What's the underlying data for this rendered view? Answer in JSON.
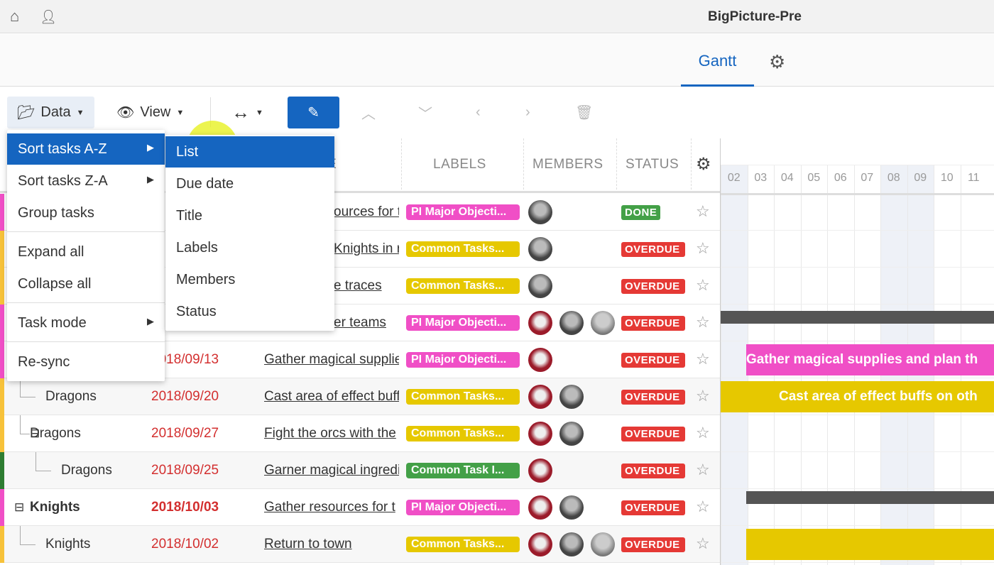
{
  "app": {
    "title": "BigPicture-Pre",
    "home_icon": "home-icon",
    "user_settings_icon": "user-gear-icon"
  },
  "tabs": {
    "gantt": "Gantt",
    "settings_icon": "gear-icon"
  },
  "toolbar": {
    "data": "Data",
    "view": "View",
    "fit_icon": "arrows-horizontal-icon",
    "edit_icon": "pencil-icon",
    "up_icon": "chevron-up-icon",
    "down_icon": "chevron-down-icon",
    "left_icon": "chevron-left-icon",
    "right_icon": "chevron-right-icon",
    "delete_icon": "trash-icon"
  },
  "columns": {
    "title": "LE",
    "labels": "LABELS",
    "members": "MEMBERS",
    "status": "STATUS"
  },
  "colors": {
    "accent": "#1565c0",
    "pink": "#f04fc6",
    "yellow": "#e6c800",
    "green": "#43a047",
    "overdue": "#e53935"
  },
  "rows": [
    {
      "name": "",
      "date": "",
      "title": "ources for t",
      "label": "PI Major Objecti...",
      "label_color": "#f04fc6",
      "members": 1,
      "status": "DONE",
      "strip": "#f04fc6",
      "partial": true
    },
    {
      "name": "",
      "date": "",
      "title": "Knights in r",
      "label": "Common Tasks...",
      "label_color": "#e6c800",
      "members": 1,
      "status": "OVERDUE",
      "strip": "#f7c23a",
      "partial": true
    },
    {
      "name": "",
      "date": "",
      "title": "e traces",
      "label": "Common Tasks...",
      "label_color": "#e6c800",
      "members": 1,
      "status": "OVERDUE",
      "strip": "#f7c23a",
      "partial": true
    },
    {
      "name": "",
      "date": "",
      "title": "er teams",
      "label": "PI Major Objecti...",
      "label_color": "#f04fc6",
      "members": 3,
      "status": "OVERDUE",
      "strip": "#f04fc6",
      "partial": true
    },
    {
      "name": "",
      "date": "2018/09/13",
      "title": "Gather magical supplies",
      "label": "PI Major Objecti...",
      "label_color": "#f04fc6",
      "members": 1,
      "status": "OVERDUE",
      "strip": "#f04fc6"
    },
    {
      "name": "Dragons",
      "date": "2018/09/20",
      "title": "Cast area of effect buffs",
      "label": "Common Tasks...",
      "label_color": "#e6c800",
      "members": 2,
      "status": "OVERDUE",
      "strip": "#f7c23a",
      "indent": 1
    },
    {
      "name": "Dragons",
      "date": "2018/09/27",
      "title": "Fight the orcs with the",
      "label": "Common Tasks...",
      "label_color": "#e6c800",
      "members": 2,
      "status": "OVERDUE",
      "strip": "#f7c23a",
      "indent": 1,
      "toggle": "⊟"
    },
    {
      "name": "Dragons",
      "date": "2018/09/25",
      "title": "Garner magical ingredients",
      "label": "Common Task I...",
      "label_color": "#43a047",
      "members": 1,
      "status": "OVERDUE",
      "strip": "#2e7d32",
      "indent": 2
    },
    {
      "name": "Knights",
      "date": "2018/10/03",
      "title": "Gather resources for t",
      "label": "PI Major Objecti...",
      "label_color": "#f04fc6",
      "members": 2,
      "status": "OVERDUE",
      "strip": "#f04fc6",
      "indent": 0,
      "toggle": "⊟",
      "bold": true
    },
    {
      "name": "Knights",
      "date": "2018/10/02",
      "title": "Return to town",
      "label": "Common Tasks...",
      "label_color": "#e6c800",
      "members": 3,
      "status": "OVERDUE",
      "strip": "#f7c23a",
      "indent": 1
    }
  ],
  "timeline": {
    "days": [
      "02",
      "03",
      "04",
      "05",
      "06",
      "07",
      "08",
      "09",
      "10",
      "11"
    ],
    "weekend": [
      "02",
      "08",
      "09"
    ],
    "bars": [
      {
        "row": 3,
        "start": 0,
        "type": "summary"
      },
      {
        "row": 4,
        "start": 1,
        "text": "Gather magical supplies and plan th",
        "color": "#f04fc6"
      },
      {
        "row": 5,
        "start": 0,
        "text": "Cast area of effect buffs on oth",
        "color": "#e6c800"
      },
      {
        "row": 8,
        "start": 1,
        "type": "summary"
      },
      {
        "row": 9,
        "start": 1,
        "text": "",
        "color": "#e6c800"
      }
    ]
  },
  "data_menu": {
    "items": [
      "Sort tasks A-Z",
      "Sort tasks Z-A",
      "Group tasks",
      "Expand all",
      "Collapse all",
      "Task mode",
      "Re-sync"
    ]
  },
  "sort_submenu": {
    "items": [
      "List",
      "Due date",
      "Title",
      "Labels",
      "Members",
      "Status"
    ]
  }
}
